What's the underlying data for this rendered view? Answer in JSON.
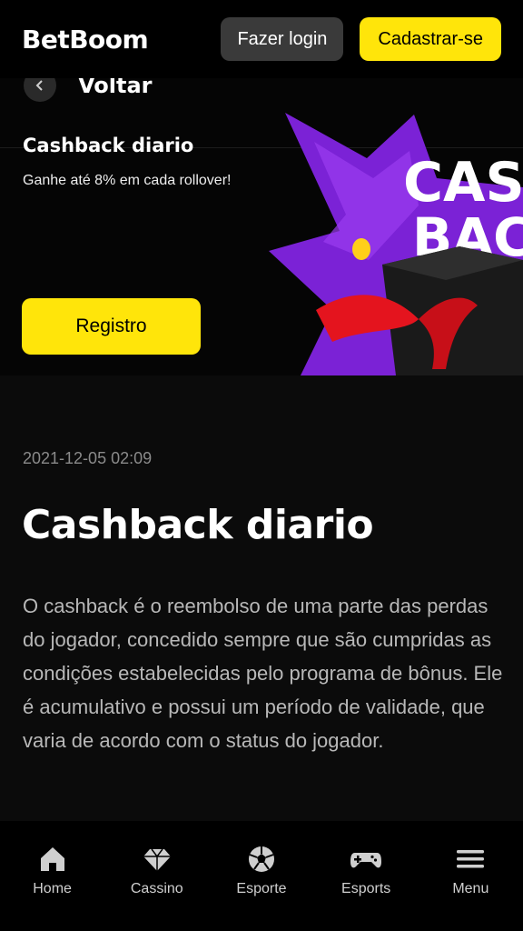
{
  "header": {
    "logo": "BetBoom",
    "login_label": "Fazer login",
    "register_label": "Cadastrar-se"
  },
  "banner": {
    "back_label": "Voltar",
    "title": "Cashback diario",
    "subtitle": "Ganhe até 8% em cada rollover!",
    "button_label": "Registro",
    "art_text_line1": "CASH",
    "art_text_line2": "BACK"
  },
  "article": {
    "date": "2021-12-05 02:09",
    "title": "Cashback diario",
    "body": "O cashback é o reembolso de uma parte das perdas do jogador, concedido sempre que são cumpridas as condições estabelecidas pelo programa de bônus. Ele é acumulativo e possui um período de validade, que varia de acordo com o status do jogador."
  },
  "bottom_nav": {
    "items": [
      {
        "label": "Home",
        "icon": "home-icon"
      },
      {
        "label": "Cassino",
        "icon": "diamond-icon"
      },
      {
        "label": "Esporte",
        "icon": "soccer-ball-icon"
      },
      {
        "label": "Esports",
        "icon": "gamepad-icon"
      },
      {
        "label": "Menu",
        "icon": "menu-icon"
      }
    ]
  },
  "colors": {
    "accent": "#ffe50a",
    "background": "#0b0b0b",
    "art_purple": "#7b22d6"
  }
}
